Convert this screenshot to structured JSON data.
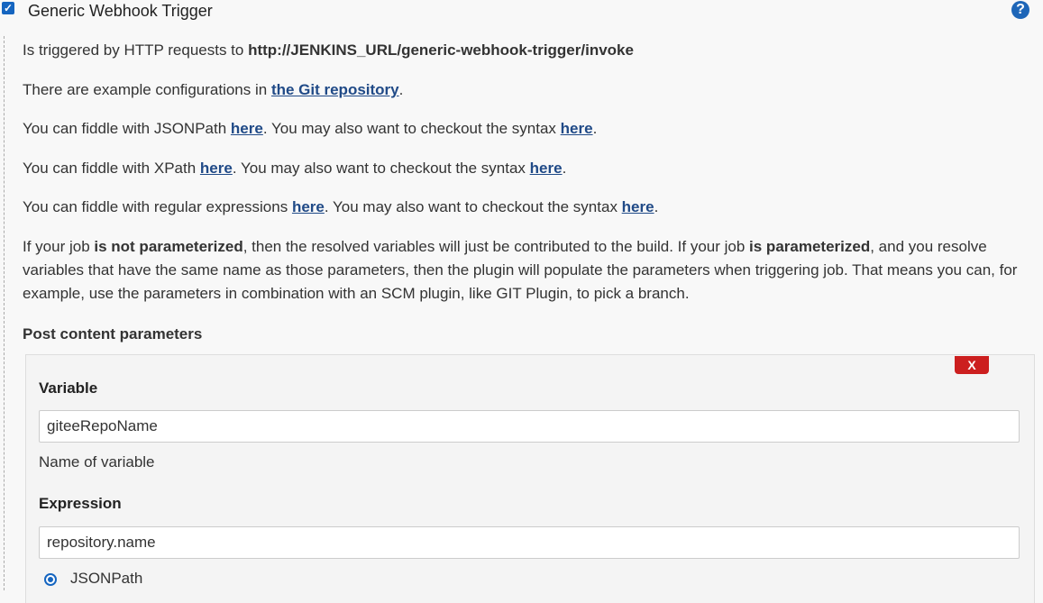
{
  "header": {
    "checkbox_glyph": "✓",
    "title": "Generic Webhook Trigger",
    "help_glyph": "?"
  },
  "intro": {
    "triggered_prefix": "Is triggered by HTTP requests to ",
    "triggered_url": "http://JENKINS_URL/generic-webhook-trigger/invoke",
    "examples_prefix": "There are example configurations in ",
    "examples_link": "the Git repository",
    "examples_suffix": ".",
    "jsonpath_prefix": "You can fiddle with JSONPath ",
    "jsonpath_link1": "here",
    "jsonpath_mid": ". You may also want to checkout the syntax ",
    "jsonpath_link2": "here",
    "jsonpath_suffix": ".",
    "xpath_prefix": "You can fiddle with XPath ",
    "xpath_link1": "here",
    "xpath_mid": ". You may also want to checkout the syntax ",
    "xpath_link2": "here",
    "xpath_suffix": ".",
    "regex_prefix": "You can fiddle with regular expressions ",
    "regex_link1": "here",
    "regex_mid": ". You may also want to checkout the syntax ",
    "regex_link2": "here",
    "regex_suffix": ".",
    "param_p1": "If your job ",
    "param_b1": "is not parameterized",
    "param_p2": ", then the resolved variables will just be contributed to the build. If your job ",
    "param_b2": "is parameterized",
    "param_p3": ", and you resolve variables that have the same name as those parameters, then the plugin will populate the parameters when triggering job. That means you can, for example, use the parameters in combination with an SCM plugin, like GIT Plugin, to pick a branch."
  },
  "post_content": {
    "section_label": "Post content parameters",
    "delete_label": "X",
    "variable_label": "Variable",
    "variable_value": "giteeRepoName",
    "variable_hint": "Name of variable",
    "expression_label": "Expression",
    "expression_value": "repository.name",
    "radio_option": "JSONPath"
  }
}
